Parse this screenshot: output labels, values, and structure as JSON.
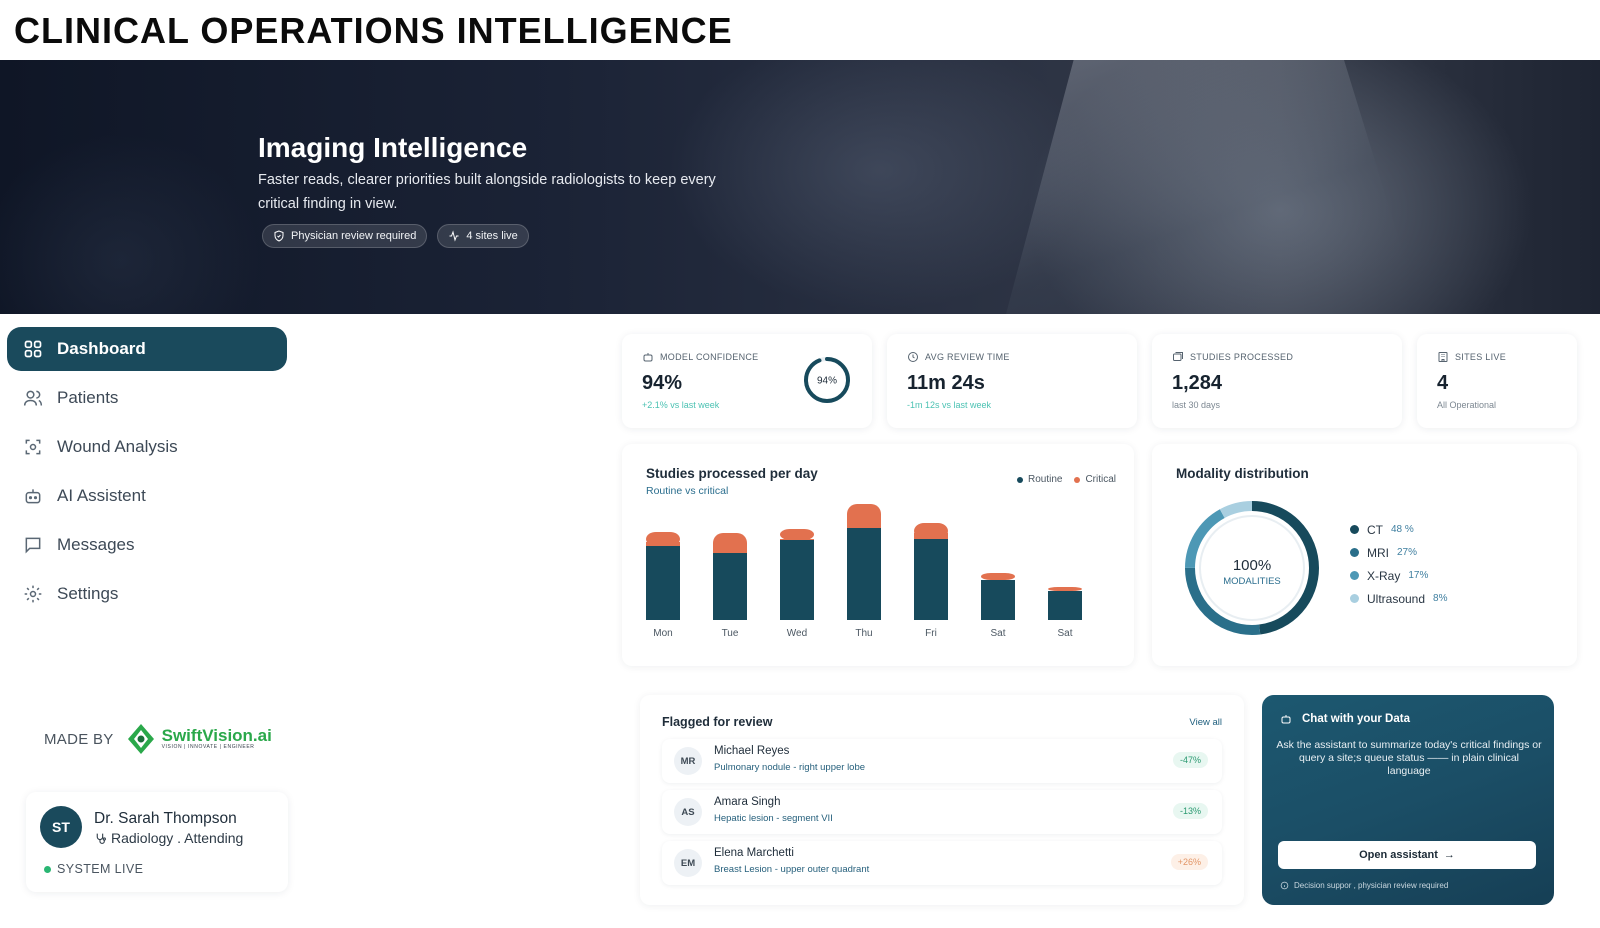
{
  "page_title": "CLINICAL OPERATIONS INTELLIGENCE",
  "hero": {
    "title": "Imaging Intelligence",
    "subtitle": "Faster reads, clearer priorities built alongside radiologists to keep every critical finding in view.",
    "chips": [
      {
        "label": "Physician review required",
        "icon": "shield-check-icon"
      },
      {
        "label": "4 sites live",
        "icon": "activity-icon"
      }
    ]
  },
  "nav": {
    "items": [
      {
        "label": "Dashboard",
        "icon": "grid-icon",
        "active": true
      },
      {
        "label": "Patients",
        "icon": "users-icon"
      },
      {
        "label": "Wound Analysis",
        "icon": "scan-icon"
      },
      {
        "label": "AI Assistent",
        "icon": "bot-icon"
      },
      {
        "label": "Messages",
        "icon": "message-icon"
      },
      {
        "label": "Settings",
        "icon": "gear-icon"
      }
    ]
  },
  "made_by": {
    "label": "MADE BY",
    "brand": "SwiftVision.ai",
    "tagline": "VISION | INNOVATE | ENGINEER"
  },
  "user": {
    "initials": "ST",
    "name": "Dr. Sarah Thompson",
    "role": "Radiology . Attending",
    "status": "SYSTEM LIVE"
  },
  "stats": [
    {
      "label": "MODEL CONFIDENCE",
      "value": "94%",
      "note": "+2.1% vs last week",
      "ring_label": "94%",
      "ring_fraction": 0.94
    },
    {
      "label": "AVG REVIEW TIME",
      "value": "11m 24s",
      "note": "-1m 12s vs last week"
    },
    {
      "label": "STUDIES PROCESSED",
      "value": "1,284",
      "note": "last 30 days"
    },
    {
      "label": "SITES LIVE",
      "value": "4",
      "note": "All Operational"
    }
  ],
  "bar_card": {
    "title": "Studies processed per day",
    "subtitle": "Routine vs critical",
    "legend": [
      "Routine",
      "Critical"
    ]
  },
  "chart_data": {
    "type": "bar",
    "stacked": true,
    "title": "Studies processed per day",
    "subtitle": "Routine vs critical",
    "categories": [
      "Mon",
      "Tue",
      "Wed",
      "Thu",
      "Fri",
      "Sat",
      "Sat"
    ],
    "series": [
      {
        "name": "Routine",
        "color": "#174a5c",
        "values": [
          74,
          67,
          80,
          92,
          81,
          40,
          29
        ]
      },
      {
        "name": "Critical",
        "color": "#e2714f",
        "values": [
          14,
          20,
          11,
          24,
          16,
          7,
          4
        ]
      }
    ],
    "ylim": [
      0,
      120
    ],
    "grid": false,
    "legend_position": "top-right"
  },
  "modality": {
    "title": "Modality distribution",
    "center_value": "100%",
    "center_label": "MODALITIES",
    "items": [
      {
        "name": "CT",
        "pct": "48 %",
        "value": 48,
        "color": "#174a5c"
      },
      {
        "name": "MRI",
        "pct": "27%",
        "value": 27,
        "color": "#2a6f8a"
      },
      {
        "name": "X-Ray",
        "pct": "17%",
        "value": 17,
        "color": "#4d98b5"
      },
      {
        "name": "Ultrasound",
        "pct": "8%",
        "value": 8,
        "color": "#a9cfe0"
      }
    ]
  },
  "flagged": {
    "title": "Flagged for review",
    "view_all": "View all",
    "rows": [
      {
        "initials": "MR",
        "name": "Michael Reyes",
        "desc": "Pulmonary nodule - right upper lobe",
        "badge": "-47%",
        "tone": "green"
      },
      {
        "initials": "AS",
        "name": "Amara Singh",
        "desc": "Hepatic lesion - segment VII",
        "badge": "-13%",
        "tone": "green"
      },
      {
        "initials": "EM",
        "name": "Elena Marchetti",
        "desc": "Breast Lesion - upper outer quadrant",
        "badge": "+26%",
        "tone": "orange"
      }
    ]
  },
  "chat": {
    "title": "Chat with your Data",
    "body": "Ask the assistant to summarize today's critical findings or query a site;s queue status —— in plain clinical language",
    "button": "Open assistant",
    "footer": "Decision suppor , physician review required"
  }
}
